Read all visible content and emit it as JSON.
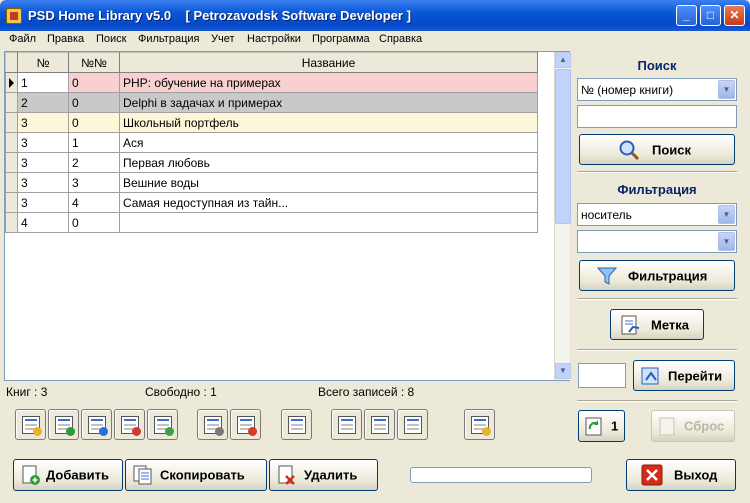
{
  "window": {
    "title": "PSD Home Library v5.0    [ Petrozavodsk Software Developer ]",
    "minimize": "_",
    "maximize": "□",
    "close": "✕"
  },
  "menu": [
    "Файл",
    "Правка",
    "Поиск",
    "Фильтрация",
    "Учет",
    "Настройки",
    "Программа",
    "Справка"
  ],
  "grid": {
    "columns": [
      "№",
      "№№",
      "Название"
    ],
    "rows": [
      {
        "n": "1",
        "nn": "0",
        "title": "PHP: обучение на примерах",
        "bg": "#f9d0d0",
        "current": true
      },
      {
        "n": "2",
        "nn": "0",
        "title": "Delphi в задачах и примерах",
        "bg": "#c9c9c9",
        "current": false
      },
      {
        "n": "3",
        "nn": "0",
        "title": "Школьный портфель",
        "bg": "#fdf6d8",
        "current": false
      },
      {
        "n": "3",
        "nn": "1",
        "title": "Ася",
        "bg": "#ffffff",
        "current": false
      },
      {
        "n": "3",
        "nn": "2",
        "title": "Первая любовь",
        "bg": "#ffffff",
        "current": false
      },
      {
        "n": "3",
        "nn": "3",
        "title": "Вешние воды",
        "bg": "#ffffff",
        "current": false
      },
      {
        "n": "3",
        "nn": "4",
        "title": "Самая недоступная из тайн...",
        "bg": "#ffffff",
        "current": false
      },
      {
        "n": "4",
        "nn": "0",
        "title": "",
        "bg": "#ffffff",
        "current": false
      }
    ]
  },
  "status": {
    "books": "Книг : 3",
    "free": "Свободно : 1",
    "total": "Всего записей : 8"
  },
  "search": {
    "title": "Поиск",
    "field": "№ (номер книги)",
    "value": "",
    "button": "Поиск"
  },
  "filter": {
    "title": "Фильтрация",
    "field": "носитель",
    "value": "",
    "button": "Фильтрация"
  },
  "mark_button": "Метка",
  "goto": {
    "value": "",
    "button": "Перейти"
  },
  "counter_button": "1",
  "reset_button": "Сброс",
  "bottom": {
    "add": "Добавить",
    "copy": "Скопировать",
    "delete": "Удалить",
    "exit": "Выход",
    "progress": 0
  },
  "colors": {
    "titlebar": "#0548c9",
    "accent": "#0a246a",
    "current_row": "#f9d0d0",
    "grey_row": "#c9c9c9",
    "yellow_row": "#fdf6d8"
  }
}
